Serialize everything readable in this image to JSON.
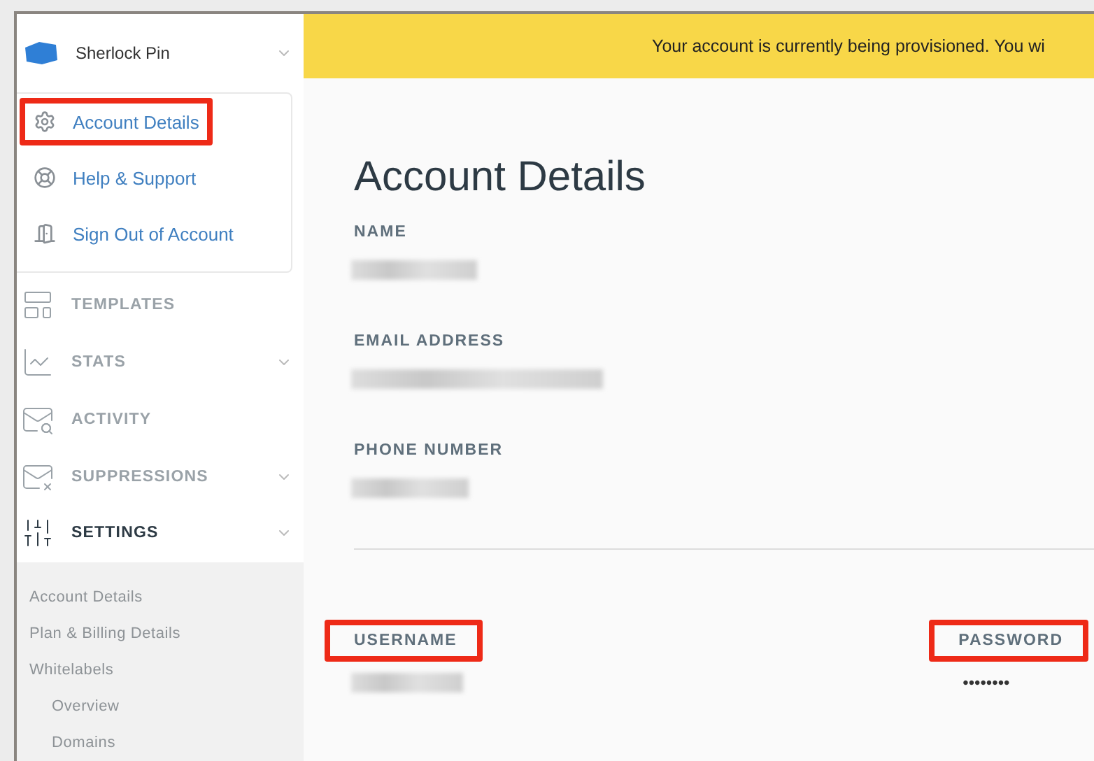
{
  "account": {
    "name": "Sherlock Pin",
    "expanded": true,
    "menu": [
      {
        "label": "Account Details",
        "kind": "settings",
        "highlighted": true
      },
      {
        "label": "Help & Support",
        "kind": "help",
        "highlighted": false
      },
      {
        "label": "Sign Out of Account",
        "kind": "signout",
        "highlighted": false
      }
    ]
  },
  "nav": [
    {
      "label": "TEMPLATES",
      "kind": "templates",
      "has_children": false,
      "selected": false
    },
    {
      "label": "STATS",
      "kind": "stats",
      "has_children": true,
      "selected": false
    },
    {
      "label": "ACTIVITY",
      "kind": "activity",
      "has_children": false,
      "selected": false
    },
    {
      "label": "SUPPRESSIONS",
      "kind": "suppressions",
      "has_children": true,
      "selected": false
    },
    {
      "label": "SETTINGS",
      "kind": "settings",
      "has_children": true,
      "selected": true
    }
  ],
  "settings_submenu": [
    {
      "label": "Account Details"
    },
    {
      "label": "Plan & Billing Details"
    },
    {
      "label": "Whitelabels",
      "children": [
        {
          "label": "Overview"
        },
        {
          "label": "Domains"
        }
      ]
    }
  ],
  "banner": {
    "text": "Your account is currently being provisioned. You wi"
  },
  "page": {
    "title": "Account Details",
    "fields": [
      {
        "label": "NAME",
        "kind": "blurred"
      },
      {
        "label": "EMAIL ADDRESS",
        "kind": "blurred"
      },
      {
        "label": "PHONE NUMBER",
        "kind": "blurred"
      }
    ],
    "credentials": [
      {
        "label": "USERNAME",
        "kind": "blurred",
        "highlighted": true
      },
      {
        "label": "PASSWORD",
        "kind": "masked",
        "value": "••••••••",
        "highlighted": true
      }
    ]
  }
}
